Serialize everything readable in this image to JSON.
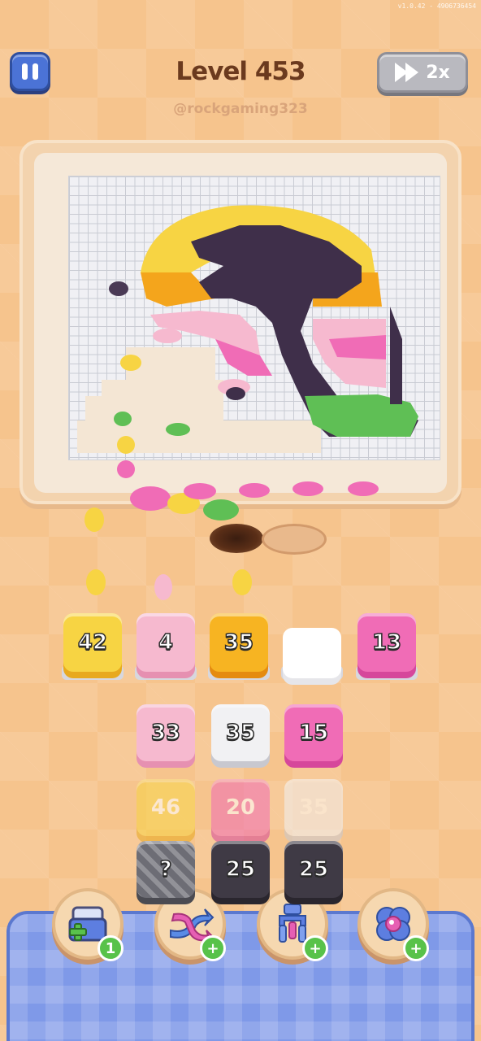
{
  "build": "v1.0.42 - 4906736454",
  "header": {
    "level_title": "Level 453",
    "username": "@rockgaming323",
    "speed_label": "2x"
  },
  "collector_slots": [
    {
      "value": "42",
      "color": "#f7d443",
      "shade": "#e8a91e"
    },
    {
      "value": "4",
      "color": "#f6b9cf",
      "shade": "#e690b1"
    },
    {
      "value": "35",
      "color": "#f7b422",
      "shade": "#e58b10"
    },
    {
      "value": "",
      "color": "#ffffff",
      "shade": "#e6e6ea"
    },
    {
      "value": "13",
      "color": "#f06cb6",
      "shade": "#d6479b"
    }
  ],
  "stacks": [
    {
      "value": "33",
      "color": "#f6b9cf",
      "shade": "#e690b1",
      "faded": false
    },
    {
      "value": "35",
      "color": "#f1f1f3",
      "shade": "#c8c8cf",
      "faded": false
    },
    {
      "value": "15",
      "color": "#f06cb6",
      "shade": "#d6479b",
      "faded": false
    },
    {
      "value": "46",
      "color": "#f7d443",
      "shade": "#e8a91e",
      "faded": true
    },
    {
      "value": "20",
      "color": "#f06cb6",
      "shade": "#d6479b",
      "faded": true
    },
    {
      "value": "35",
      "color": "#f1f1f3",
      "shade": "#c8c8cf",
      "faded": true
    },
    {
      "value": "?",
      "color": "#6d6d75",
      "shade": "#4b4b52",
      "faded": false
    },
    {
      "value": "25",
      "color": "#3f3a45",
      "shade": "#2a262e",
      "faded": false
    },
    {
      "value": "25",
      "color": "#3f3a45",
      "shade": "#2a262e",
      "faded": false
    }
  ],
  "boosters": [
    {
      "name": "add-slot",
      "badge": "1"
    },
    {
      "name": "shuffle",
      "badge": "+"
    },
    {
      "name": "magnet",
      "badge": "+"
    },
    {
      "name": "hint",
      "badge": "+"
    }
  ]
}
